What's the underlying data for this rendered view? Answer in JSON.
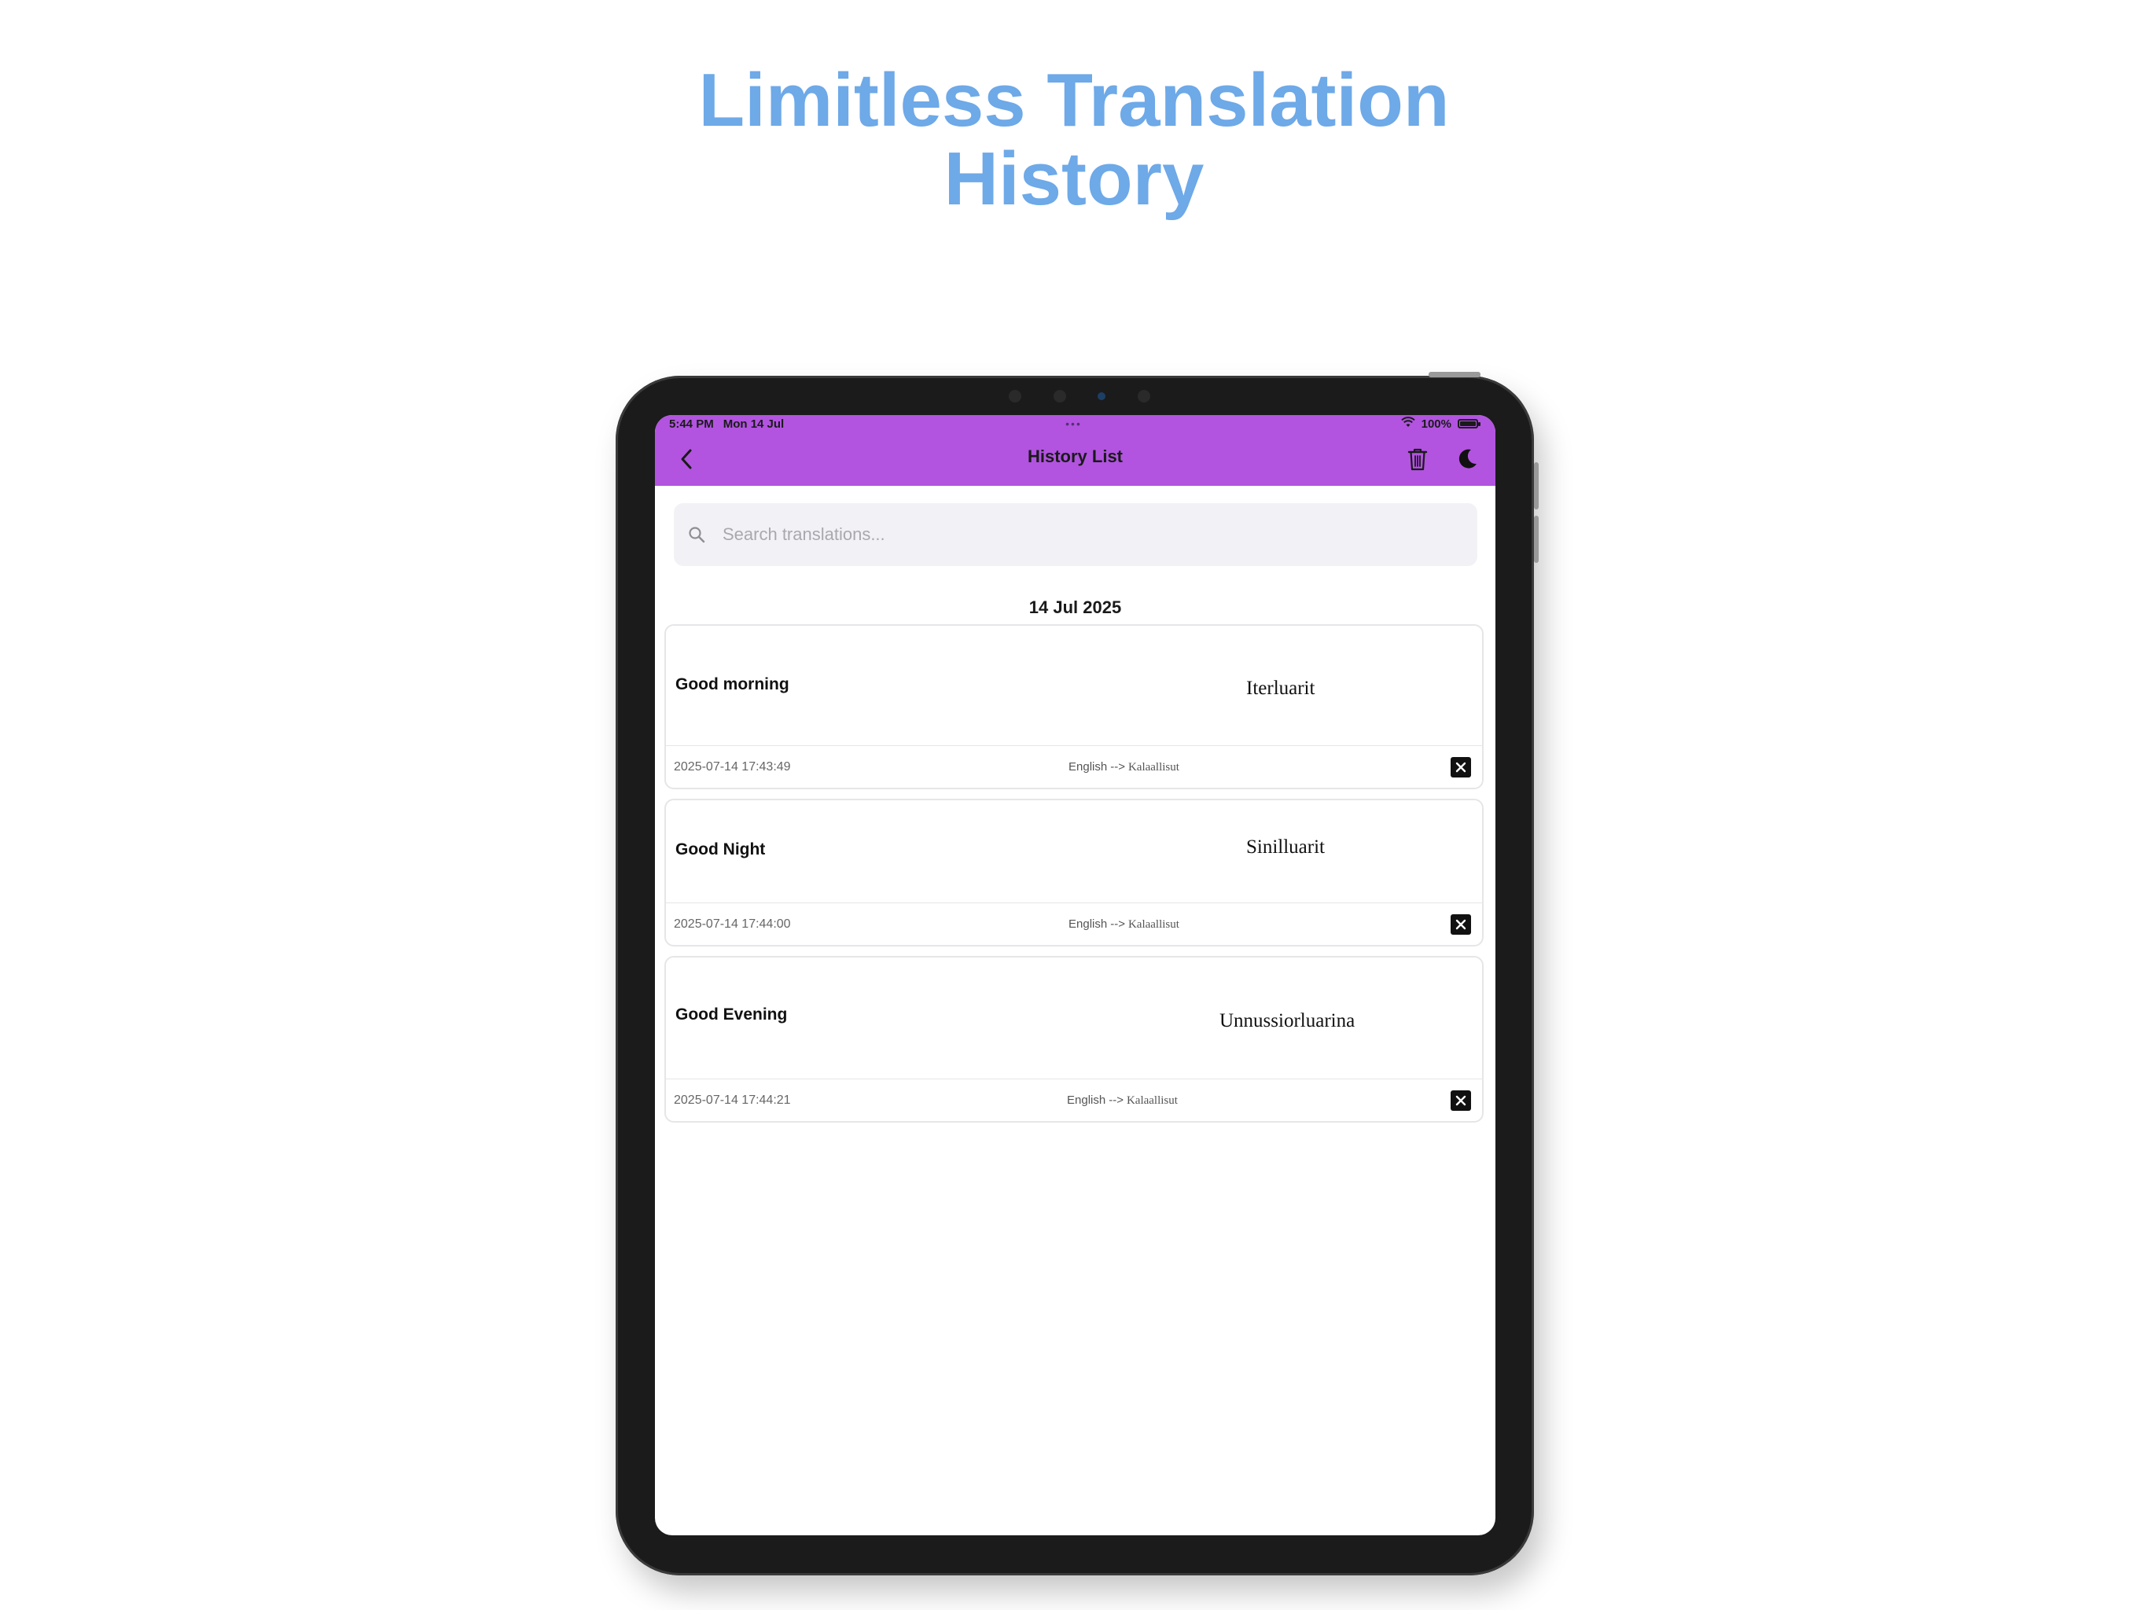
{
  "promo": {
    "title_line1": "Limitless Translation",
    "title_line2": "History"
  },
  "status_bar": {
    "time": "5:44 PM",
    "date": "Mon 14 Jul",
    "battery": "100%"
  },
  "header": {
    "title": "History List",
    "background_color": "#b254e0"
  },
  "search": {
    "placeholder": "Search translations..."
  },
  "sections": [
    {
      "date": "14 Jul 2025",
      "entries": [
        {
          "source": "Good morning",
          "translation": "Iterluarit",
          "timestamp": "2025-07-14 17:43:49",
          "source_lang": "English",
          "arrow": "-->",
          "target_lang": "Kalaallisut"
        },
        {
          "source": "Good Night",
          "translation": "Sinilluarit",
          "timestamp": "2025-07-14 17:44:00",
          "source_lang": "English",
          "arrow": "-->",
          "target_lang": "Kalaallisut"
        },
        {
          "source": "Good Evening",
          "translation": "Unnussiorluarina",
          "timestamp": "2025-07-14 17:44:21",
          "source_lang": "English",
          "arrow": "-->",
          "target_lang": "Kalaallisut"
        }
      ]
    }
  ],
  "icons": {
    "back": "chevron-left-icon",
    "delete_all": "trash-icon",
    "theme": "moon-icon",
    "search": "search-icon",
    "remove_entry": "close-icon",
    "wifi": "wifi-icon",
    "battery": "battery-icon"
  }
}
